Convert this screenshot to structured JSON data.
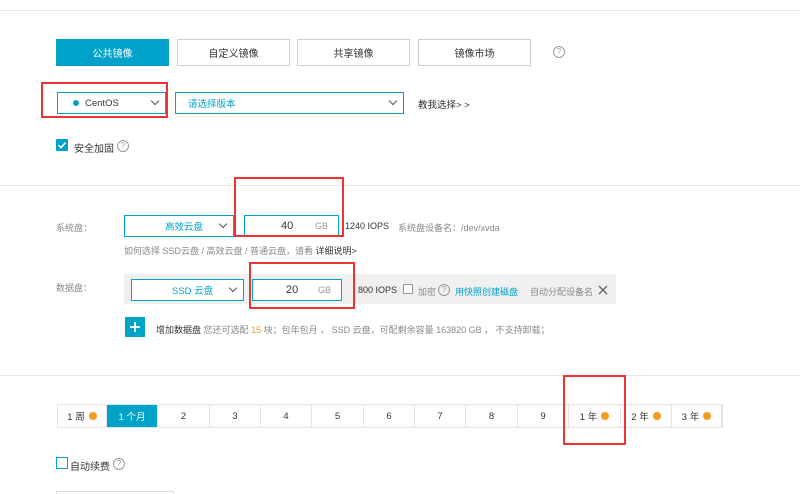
{
  "image_tabs": [
    {
      "label": "公共镜像",
      "active": true
    },
    {
      "label": "自定义镜像",
      "active": false
    },
    {
      "label": "共享镜像",
      "active": false
    },
    {
      "label": "镜像市场",
      "active": false
    }
  ],
  "os_select": {
    "value": "CentOS"
  },
  "version_select": {
    "placeholder": "请选择版本"
  },
  "help_me_choose": "教我选择> >",
  "security_harden": {
    "label": "安全加固",
    "checked": true
  },
  "system_disk": {
    "label": "系统盘：",
    "type": "高效云盘",
    "size": "40",
    "unit": "GB",
    "iops": "1240 IOPS",
    "device_name": "系统盘设备名：/dev/xvda",
    "help_text": "如何选择 SSD云盘 / 高效云盘 / 普通云盘，请看",
    "help_link": "详细说明>"
  },
  "data_disk": {
    "label": "数据盘：",
    "type": "SSD 云盘",
    "size": "20",
    "unit": "GB",
    "iops": "800 IOPS",
    "encrypt_label": "加密",
    "snapshot_link": "用快照创建磁盘",
    "auto_device": "自动分配设备名"
  },
  "add_disk": {
    "label": "增加数据盘",
    "info_prefix": "您还可选配",
    "count": "15",
    "info_suffix": "块；包年包月 ， SSD 云盘，可配剩余容量 163820 GB ， 不支持卸载；"
  },
  "periods": [
    {
      "label": "1 周",
      "badge": true,
      "active": false
    },
    {
      "label": "1 个月",
      "badge": false,
      "active": true
    },
    {
      "label": "2",
      "badge": false,
      "active": false
    },
    {
      "label": "3",
      "badge": false,
      "active": false
    },
    {
      "label": "4",
      "badge": false,
      "active": false
    },
    {
      "label": "5",
      "badge": false,
      "active": false
    },
    {
      "label": "6",
      "badge": false,
      "active": false
    },
    {
      "label": "7",
      "badge": false,
      "active": false
    },
    {
      "label": "8",
      "badge": false,
      "active": false
    },
    {
      "label": "9",
      "badge": false,
      "active": false
    },
    {
      "label": "1 年",
      "badge": true,
      "active": false
    },
    {
      "label": "2 年",
      "badge": true,
      "active": false
    },
    {
      "label": "3 年",
      "badge": true,
      "active": false
    }
  ],
  "auto_renew": {
    "label": "自动续费",
    "checked": false
  },
  "colors": {
    "accent": "#00a2ca",
    "highlight_box": "#e33333",
    "badge": "#f39a1c"
  }
}
